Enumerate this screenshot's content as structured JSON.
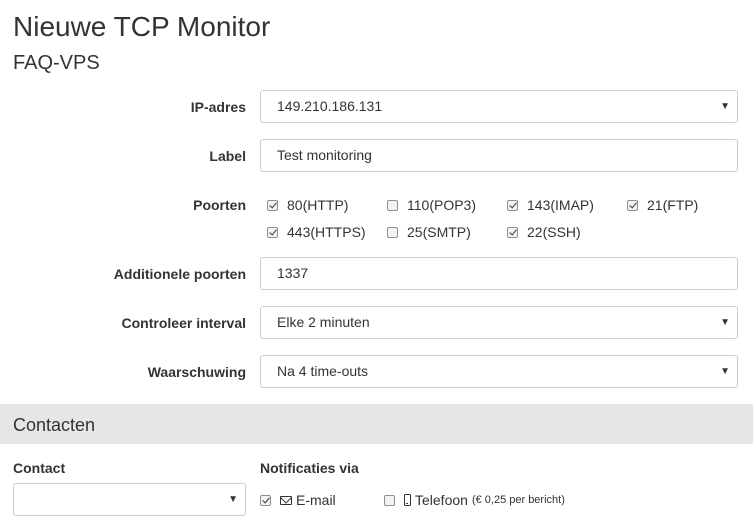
{
  "header": {
    "title": "Nieuwe TCP Monitor",
    "subtitle": "FAQ-VPS"
  },
  "form": {
    "ip": {
      "label": "IP-adres",
      "value": "149.210.186.131"
    },
    "label_field": {
      "label": "Label",
      "value": "Test monitoring"
    },
    "ports": {
      "label": "Poorten",
      "options": [
        {
          "label": "80(HTTP)",
          "checked": true
        },
        {
          "label": "110(POP3)",
          "checked": false
        },
        {
          "label": "143(IMAP)",
          "checked": true
        },
        {
          "label": "21(FTP)",
          "checked": true
        },
        {
          "label": "443(HTTPS)",
          "checked": true
        },
        {
          "label": "25(SMTP)",
          "checked": false
        },
        {
          "label": "22(SSH)",
          "checked": true
        }
      ]
    },
    "extra_ports": {
      "label": "Additionele poorten",
      "value": "1337"
    },
    "interval": {
      "label": "Controleer interval",
      "value": "Elke 2 minuten"
    },
    "warning": {
      "label": "Waarschuwing",
      "value": "Na 4 time-outs"
    }
  },
  "contacts": {
    "title": "Contacten",
    "contact_label": "Contact",
    "contact_value": "",
    "notify_label": "Notificaties via",
    "email": {
      "label": "E-mail",
      "checked": true
    },
    "phone": {
      "label": "Telefoon",
      "note": "(€ 0,25 per bericht)",
      "checked": false
    }
  },
  "icons": {
    "dropdown": "chevron-down-icon",
    "email": "envelope-icon",
    "phone": "mobile-phone-icon"
  }
}
